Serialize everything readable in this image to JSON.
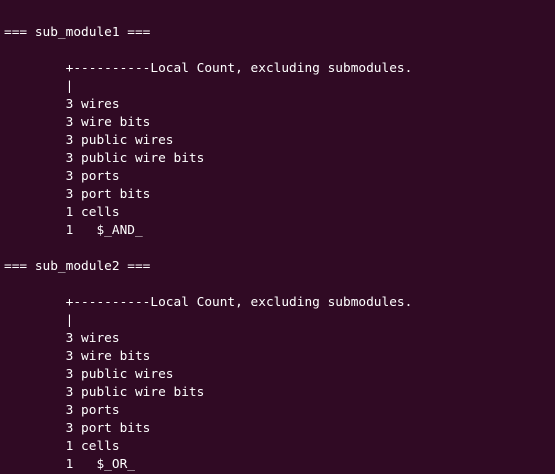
{
  "terminal": {
    "lines": [
      "=== sub_module1 ===",
      "",
      "        +----------Local Count, excluding submodules.",
      "        |",
      "        3 wires",
      "        3 wire bits",
      "        3 public wires",
      "        3 public wire bits",
      "        3 ports",
      "        3 port bits",
      "        1 cells",
      "        1   $_AND_",
      "",
      "=== sub_module2 ===",
      "",
      "        +----------Local Count, excluding submodules.",
      "        |",
      "        3 wires",
      "        3 wire bits",
      "        3 public wires",
      "        3 public wire bits",
      "        3 ports",
      "        3 port bits",
      "        1 cells",
      "        1   $_OR_"
    ]
  }
}
